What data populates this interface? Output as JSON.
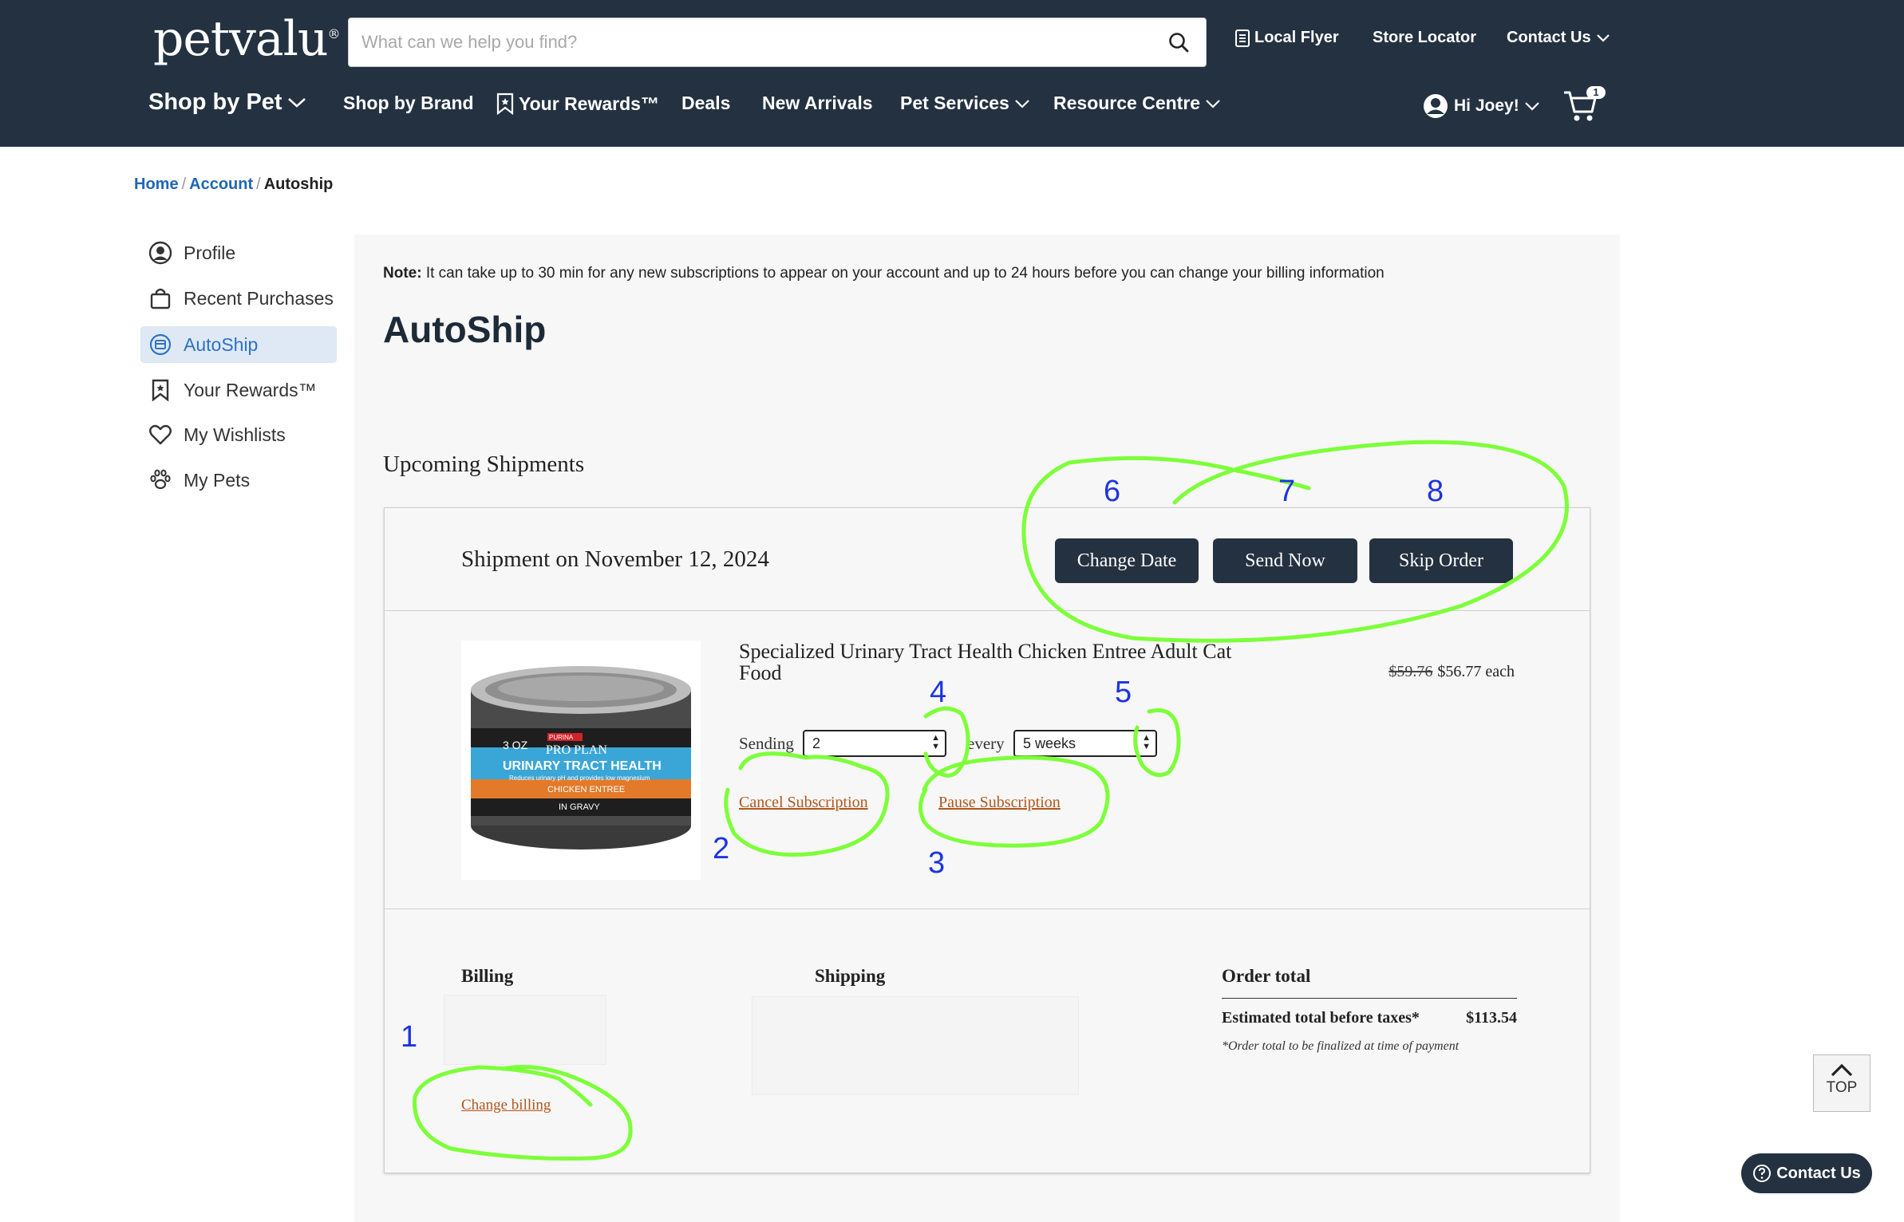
{
  "header": {
    "logo": "petvalu",
    "search_placeholder": "What can we help you find?",
    "top_links": {
      "flyer": "Local Flyer",
      "store": "Store Locator",
      "contact": "Contact Us"
    },
    "nav": {
      "shop_by_pet": "Shop by Pet",
      "shop_by_brand": "Shop by Brand",
      "rewards": "Your Rewards™",
      "deals": "Deals",
      "new_arrivals": "New Arrivals",
      "pet_services": "Pet Services",
      "resource_centre": "Resource Centre",
      "greeting": "Hi Joey!",
      "cart_count": "1"
    }
  },
  "breadcrumb": {
    "home": "Home",
    "account": "Account",
    "current": "Autoship"
  },
  "sidebar": {
    "items": [
      {
        "label": "Profile",
        "icon": "profile-icon"
      },
      {
        "label": "Recent Purchases",
        "icon": "shopping-bag-icon"
      },
      {
        "label": "AutoShip",
        "icon": "autoship-icon",
        "active": true
      },
      {
        "label": "Your Rewards™",
        "icon": "bookmark-icon"
      },
      {
        "label": "My Wishlists",
        "icon": "heart-icon"
      },
      {
        "label": "My Pets",
        "icon": "paw-icon"
      }
    ]
  },
  "main": {
    "note_label": "Note:",
    "note_text": " It can take up to 30 min for any new subscriptions to appear on your account and up to 24 hours before you can change your billing information",
    "title": "AutoShip",
    "section_title": "Upcoming Shipments",
    "shipment": {
      "date_label": "Shipment on November 12, 2024",
      "buttons": {
        "change_date": "Change Date",
        "send_now": "Send Now",
        "skip_order": "Skip Order"
      },
      "product": {
        "name": "Specialized Urinary Tract Health Chicken Entree Adult Cat Food",
        "old_price": "$59.76",
        "new_price": "$56.77 each",
        "sending_label": "Sending",
        "quantity": "2",
        "every_label": "every",
        "frequency": "5 weeks",
        "cancel_link": "Cancel Subscription",
        "pause_link": "Pause Subscription",
        "can_text": {
          "size": "3 OZ",
          "brand_top": "PURINA",
          "brand": "PRO PLAN",
          "line": "URINARY TRACT HEALTH",
          "sub": "Reduces urinary pH and provides low magnesium",
          "flavor1": "CHICKEN ENTREE",
          "flavor2": "IN GRAVY"
        }
      },
      "billing": {
        "heading": "Billing",
        "change_link": "Change billing"
      },
      "shipping": {
        "heading": "Shipping"
      },
      "order_total": {
        "heading": "Order total",
        "label": "Estimated total before taxes*",
        "value": "$113.54",
        "note": "*Order total to be finalized at time of payment"
      }
    }
  },
  "annotations": [
    "1",
    "2",
    "3",
    "4",
    "5",
    "6",
    "7",
    "8"
  ],
  "floating": {
    "top": "TOP",
    "contact": "Contact Us"
  },
  "colors": {
    "header_bg": "#243141",
    "accent_blue": "#2d72c4",
    "link_orange": "#b2571b",
    "annotation_green": "#7dff3a",
    "annotation_blue": "#1d34e0"
  }
}
